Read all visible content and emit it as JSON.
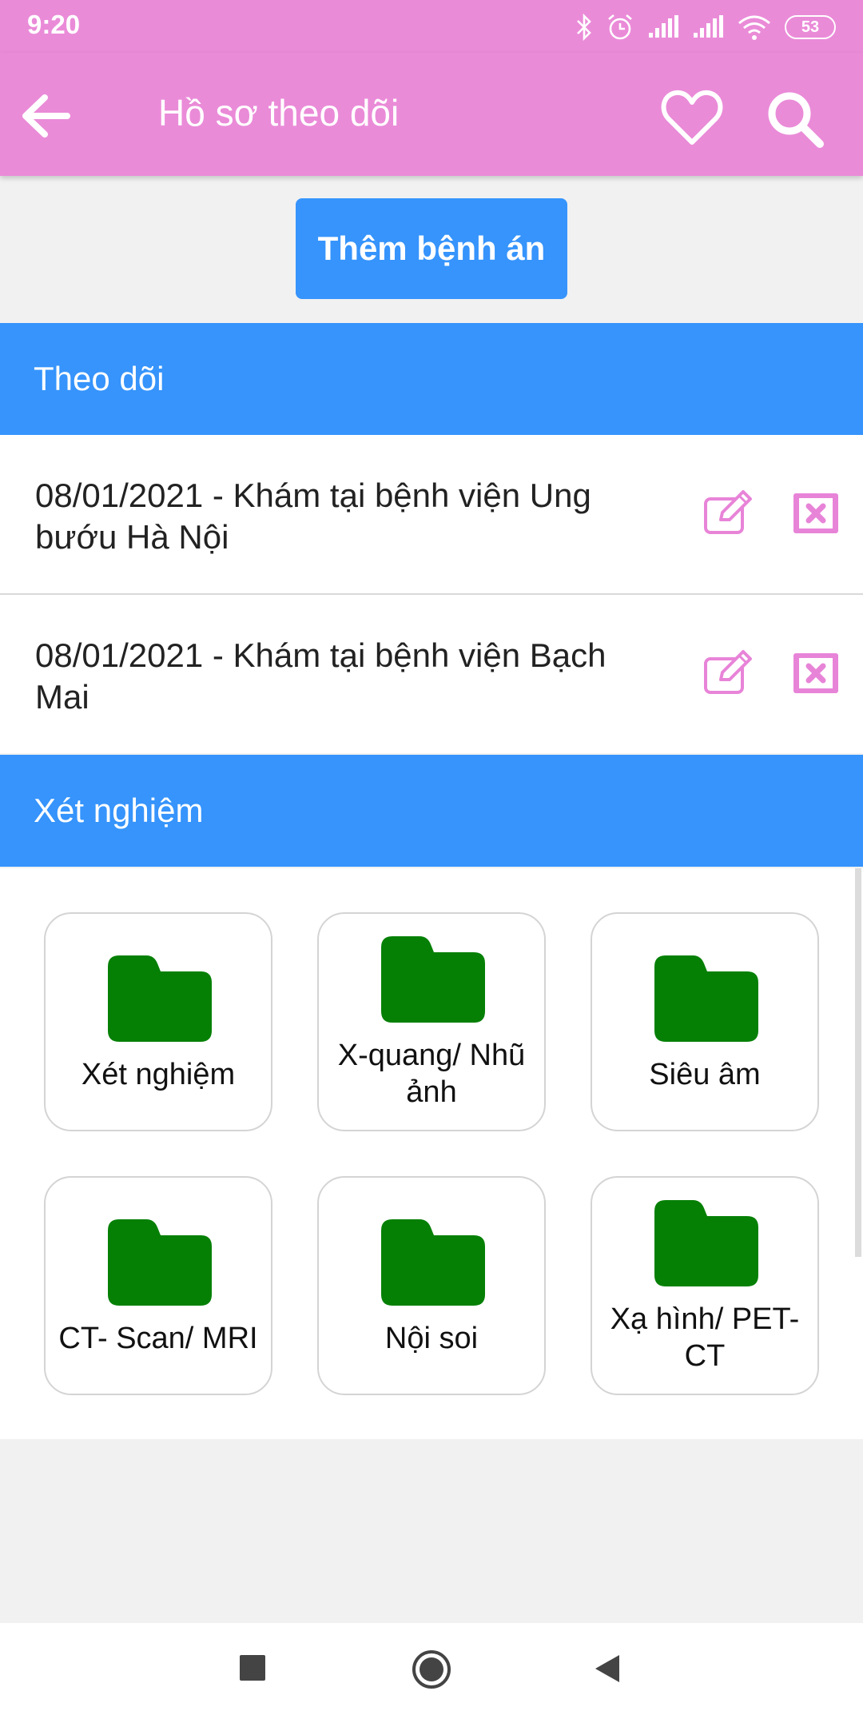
{
  "status_bar": {
    "time": "9:20",
    "battery": "53"
  },
  "app_bar": {
    "title": "Hồ sơ theo dõi"
  },
  "add_button": {
    "label": "Thêm bệnh án"
  },
  "follow_section": {
    "title": "Theo dõi",
    "records": [
      {
        "line1": "08/01/2021 - Khám tại bệnh viện Ung",
        "line2": "bướu Hà Nội"
      },
      {
        "line1": "08/01/2021 - Khám tại bệnh viện Bạch",
        "line2": "Mai"
      }
    ]
  },
  "test_section": {
    "title": "Xét nghiệm",
    "folders": [
      {
        "line1": "Xét nghiệm",
        "line2": ""
      },
      {
        "line1": "X-quang/ Nhũ",
        "line2": "ảnh"
      },
      {
        "line1": "Siêu âm",
        "line2": ""
      },
      {
        "line1": "CT- Scan/ MRI",
        "line2": ""
      },
      {
        "line1": "Nội soi",
        "line2": ""
      },
      {
        "line1": "Xạ hình/ PET-",
        "line2": "CT"
      }
    ]
  },
  "colors": {
    "app_bar": "#ea8bd8",
    "primary": "#3694fc",
    "folder": "#058005",
    "action_icon": "#e884d8"
  }
}
